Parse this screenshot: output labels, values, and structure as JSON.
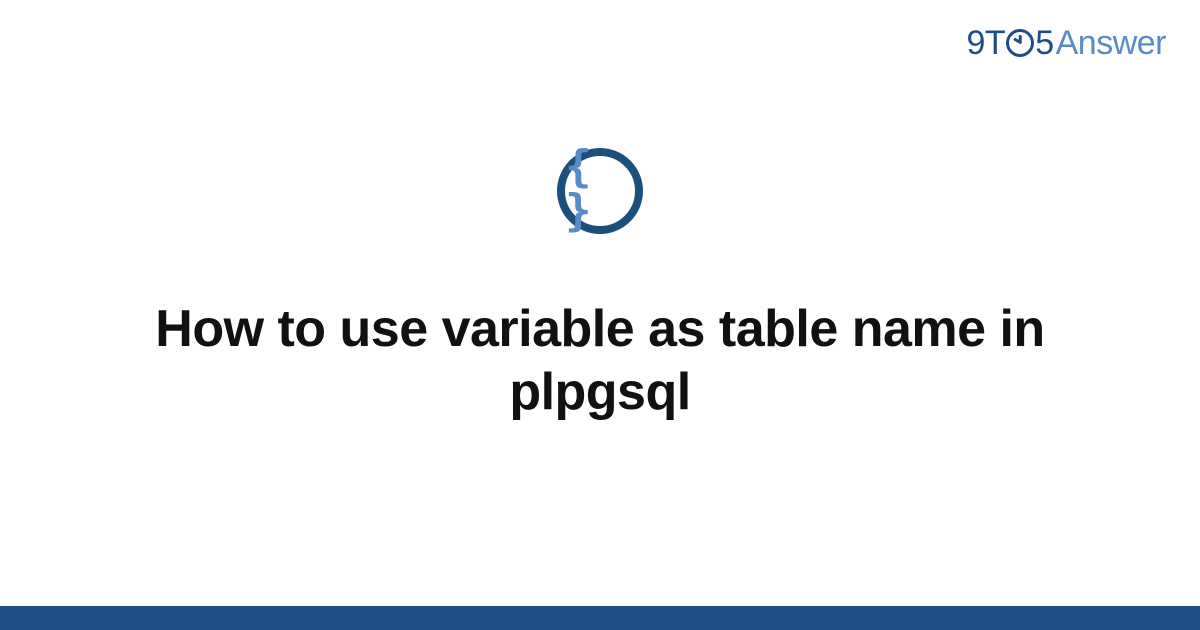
{
  "brand": {
    "part1": "9T",
    "part2": "5",
    "part3": "Answer"
  },
  "icon": {
    "name": "code-braces-icon",
    "glyph": "{ }"
  },
  "title": "How to use variable as table name in plpgsql",
  "colors": {
    "brand_dark": "#204d86",
    "brand_light": "#5a8bc9",
    "icon_ring": "#1c4f7c",
    "text": "#111111",
    "bg": "#ffffff"
  }
}
